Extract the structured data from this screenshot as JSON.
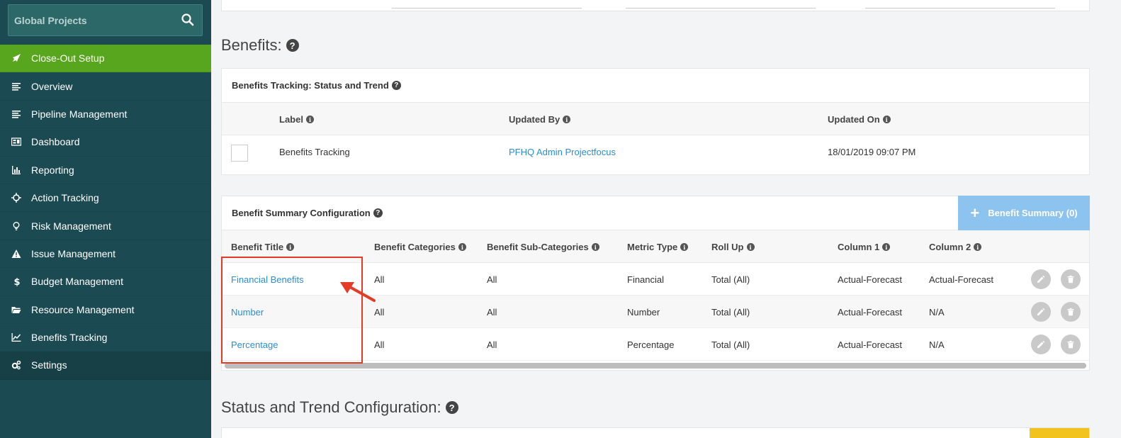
{
  "sidebar": {
    "search_label": "Global Projects",
    "items": [
      {
        "label": "Close-Out Setup",
        "icon": "rocket-icon"
      },
      {
        "label": "Overview",
        "icon": "lines-icon"
      },
      {
        "label": "Pipeline Management",
        "icon": "lines-icon"
      },
      {
        "label": "Dashboard",
        "icon": "dashboard-icon"
      },
      {
        "label": "Reporting",
        "icon": "bar-chart-icon"
      },
      {
        "label": "Action Tracking",
        "icon": "crosshair-icon"
      },
      {
        "label": "Risk Management",
        "icon": "lightbulb-icon"
      },
      {
        "label": "Issue Management",
        "icon": "warning-icon"
      },
      {
        "label": "Budget Management",
        "icon": "dollar-icon"
      },
      {
        "label": "Resource Management",
        "icon": "folder-icon"
      },
      {
        "label": "Benefits Tracking",
        "icon": "line-chart-icon"
      },
      {
        "label": "Settings",
        "icon": "gears-icon"
      }
    ]
  },
  "benefits": {
    "title": "Benefits:",
    "tracking_card": {
      "title": "Benefits Tracking: Status and Trend",
      "headers": {
        "label": "Label",
        "updated_by": "Updated By",
        "updated_on": "Updated On"
      },
      "row": {
        "label": "Benefits Tracking",
        "updated_by": "PFHQ Admin Projectfocus",
        "updated_on": "18/01/2019 09:07 PM"
      }
    },
    "summary_card": {
      "title": "Benefit Summary Configuration",
      "add_button": "Benefit Summary (0)",
      "headers": {
        "title": "Benefit Title",
        "categories": "Benefit Categories",
        "subcategories": "Benefit Sub-Categories",
        "metric": "Metric Type",
        "rollup": "Roll Up",
        "col1": "Column 1",
        "col2": "Column 2"
      },
      "rows": [
        {
          "title": "Financial Benefits",
          "categories": "All",
          "subcategories": "All",
          "metric": "Financial",
          "rollup": "Total (All)",
          "col1": "Actual-Forecast",
          "col2": "Actual-Forecast"
        },
        {
          "title": "Number",
          "categories": "All",
          "subcategories": "All",
          "metric": "Number",
          "rollup": "Total (All)",
          "col1": "Actual-Forecast",
          "col2": "N/A"
        },
        {
          "title": "Percentage",
          "categories": "All",
          "subcategories": "All",
          "metric": "Percentage",
          "rollup": "Total (All)",
          "col1": "Actual-Forecast",
          "col2": "N/A"
        }
      ]
    }
  },
  "status_trend": {
    "title": "Status and Trend Configuration:"
  },
  "colors": {
    "sidebar_bg": "#1c4a52",
    "active_item": "#58a61d",
    "link": "#2a8ed4",
    "highlight": "#e53a25",
    "add_button": "#8cc4ef"
  }
}
